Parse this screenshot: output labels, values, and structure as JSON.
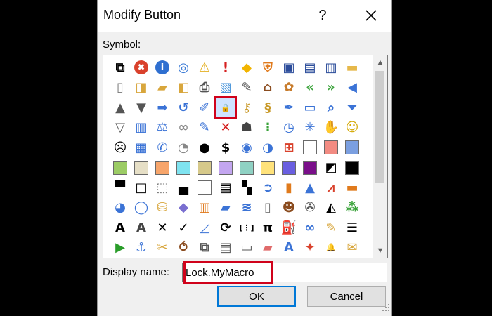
{
  "dialog": {
    "title": "Modify Button",
    "help_label": "?",
    "symbol_label": "Symbol:",
    "display_name_label": "Display name:",
    "display_name_value": "Lock.MyMacro",
    "ok_label": "OK",
    "cancel_label": "Cancel",
    "highlight_color": "#d0021b",
    "selected_symbol": "lock-icon"
  },
  "symbols": [
    [
      "org-chart-icon",
      "stop-icon",
      "info-icon",
      "target-icon",
      "warning-icon",
      "exclamation-icon",
      "warning-diamond-icon",
      "shield-icon",
      "save-icon",
      "save-all-icon",
      "save-as-icon",
      "folder-icon"
    ],
    [
      "new-document-icon",
      "open-folder-icon",
      "folders-icon",
      "open-file-icon",
      "print-icon",
      "picture-icon",
      "edit-document-icon",
      "home-icon",
      "palette-icon",
      "arrows-left-icon",
      "arrows-right-icon",
      "arrow-left-icon"
    ],
    [
      "triangle-up-icon",
      "triangle-down-icon",
      "arrow-right-icon",
      "circle-back-icon",
      "eyedropper-icon",
      "lock-icon",
      "key-icon",
      "scroll-icon",
      "pen-icon",
      "window-icon",
      "magnifier-icon",
      "filter-icon"
    ],
    [
      "funnel-icon",
      "open-book-icon",
      "scales-icon",
      "rings-icon",
      "microphone-icon",
      "no-phone-icon",
      "person-icon",
      "traffic-light-icon",
      "clock-icon",
      "snowflake-icon",
      "hand-icon",
      "smiley-icon"
    ],
    [
      "sad-face-icon",
      "calculator-icon",
      "phone-icon",
      "piggy-bank-icon",
      "eight-ball-icon",
      "dollar-icon",
      "eye-icon",
      "disc-icon",
      "windows-logo-icon",
      "white-square-icon",
      "salmon-square-icon",
      "blue-square-icon"
    ],
    [
      "green-square-icon",
      "beige-square-icon",
      "orange-square-icon",
      "cyan-square-icon",
      "khaki-square-icon",
      "lavender-square-icon",
      "teal-square-icon",
      "yellow-square-icon",
      "violet-square-icon",
      "purple-square-icon",
      "diagonal-square-icon",
      "black-square-icon"
    ],
    [
      "top-bar-square-icon",
      "outline-square-icon",
      "dotted-square-icon",
      "bottom-bar-square-icon",
      "empty-square-icon",
      "stripe-square-icon",
      "checker-square-icon",
      "circle-arrow-icon",
      "bar-chart-icon",
      "cone-icon",
      "line-chart-icon",
      "stacked-bars-icon"
    ],
    [
      "pie-chart-icon",
      "donut-chart-icon",
      "cylinder-chart-icon",
      "layers-icon",
      "books-icon",
      "stack-chart-icon",
      "waves-chart-icon",
      "blank-page-icon",
      "portrait-icon",
      "film-reel-icon",
      "mountain-chart-icon",
      "scatter-chart-icon"
    ],
    [
      "text-box-icon",
      "text-frame-icon",
      "cross-icon",
      "check-icon",
      "ruler-chart-icon",
      "refresh-icon",
      "bracket-icon",
      "pi-icon",
      "paint-bucket-icon",
      "binoculars-icon",
      "brush-icon",
      "bullet-list-icon"
    ],
    [
      "play-icon",
      "anchor-icon",
      "tools-icon",
      "loop-icon",
      "copy-pages-icon",
      "paste-icon",
      "envelope-folder-icon",
      "eraser-icon",
      "letter-a-icon",
      "logo-icon",
      "bell-icon",
      "open-envelope-icon"
    ]
  ]
}
